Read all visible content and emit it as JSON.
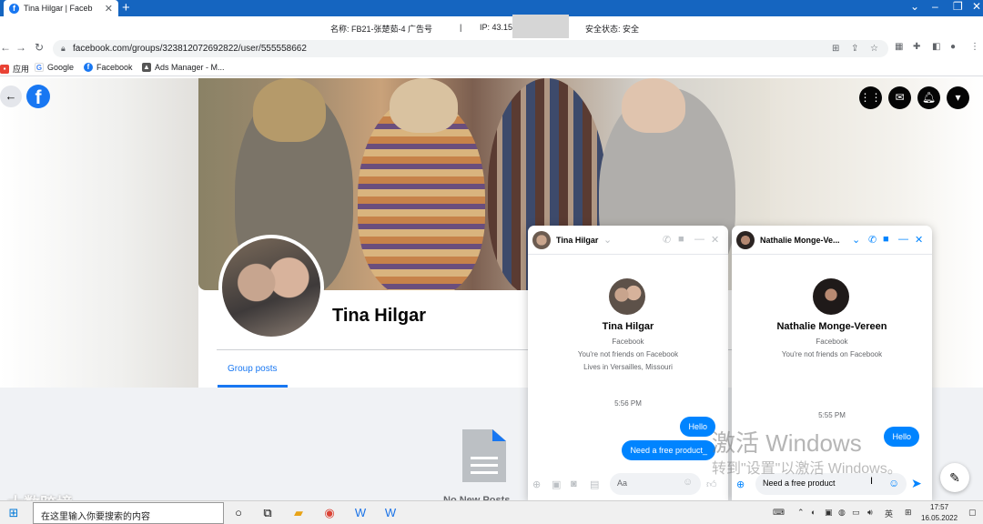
{
  "browser": {
    "tab_title": "Tina Hilgar | Faceb",
    "tab_close": "✕",
    "new_tab": "+",
    "url": "facebook.com/groups/323812072692822/user/555558662",
    "bookmarks": [
      {
        "label": "应用",
        "icon": "apps-icon"
      },
      {
        "label": "Google",
        "icon": "google-icon"
      },
      {
        "label": "Facebook",
        "icon": "facebook-icon"
      },
      {
        "label": "Ads Manager - M...",
        "icon": "ads-manager-icon"
      }
    ]
  },
  "infobar": {
    "name": "名称: FB21-张楚茹-4 广告号",
    "sep1": "|",
    "ip": "IP: 43.15",
    "sep2": "|",
    "status": "安全状态: 安全"
  },
  "facebook": {
    "profile_name": "Tina Hilgar",
    "tab_group_posts": "Group posts",
    "no_posts": "No New Posts"
  },
  "chat1": {
    "name": "Tina Hilgar",
    "header_name": "Tina Hilgar",
    "source": "Facebook",
    "friend_status": "You're not friends on Facebook",
    "location": "Lives in Versailles, Missouri",
    "time": "5:56 PM",
    "messages": [
      "Hello",
      "Need a free product_"
    ],
    "placeholder": "Aa"
  },
  "chat2": {
    "name": "Nathalie Monge-Vereen",
    "header_name": "Nathalie Monge-Ve...",
    "source": "Facebook",
    "friend_status": "You're not friends on Facebook",
    "time": "5:55 PM",
    "messages": [
      "Hello"
    ],
    "draft": "Need a free product"
  },
  "watermark": {
    "title": "激活 Windows",
    "subtitle": "转到\"设置\"以激活 Windows。",
    "logo_text": "大数跨境"
  },
  "taskbar": {
    "search_placeholder": "在这里输入你要搜索的内容",
    "time": "17:57",
    "date": "16.05.2022"
  },
  "colors": {
    "facebook_blue": "#1877f2",
    "messenger_blue": "#0084ff",
    "chrome_blue": "#1565c0"
  }
}
